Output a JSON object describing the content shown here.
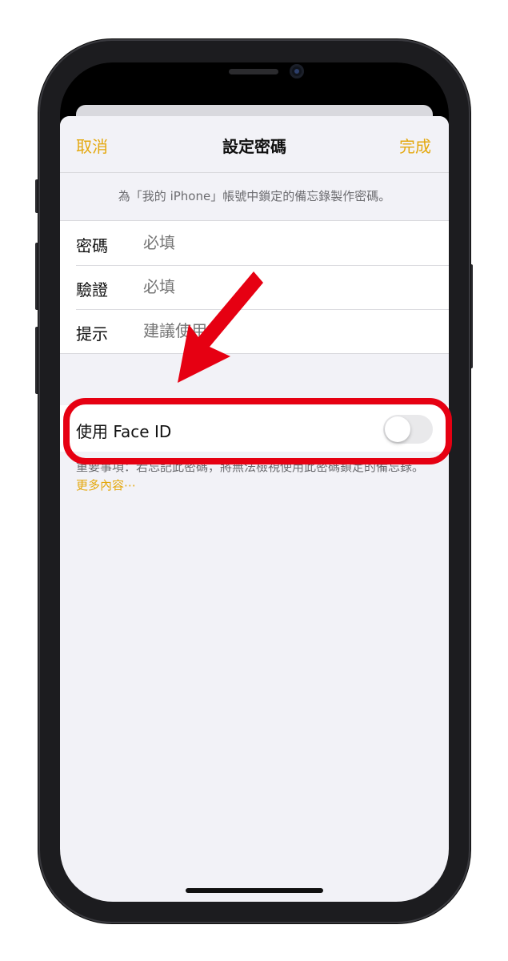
{
  "nav": {
    "cancel": "取消",
    "title": "設定密碼",
    "done": "完成"
  },
  "description": "為「我的 iPhone」帳號中鎖定的備忘錄製作密碼。",
  "form": {
    "password": {
      "label": "密碼",
      "placeholder": "必填"
    },
    "verify": {
      "label": "驗證",
      "placeholder": "必填"
    },
    "hint": {
      "label": "提示",
      "placeholder": "建議使用"
    }
  },
  "faceid": {
    "label": "使用 Face ID",
    "enabled": false
  },
  "note": {
    "text": "重要事項：若忘記此密碼，將無法檢視使用此密碼鎖定的備忘錄。",
    "link": "更多內容⋯"
  },
  "colors": {
    "accent": "#e4a80e",
    "annotation": "#e60012"
  }
}
